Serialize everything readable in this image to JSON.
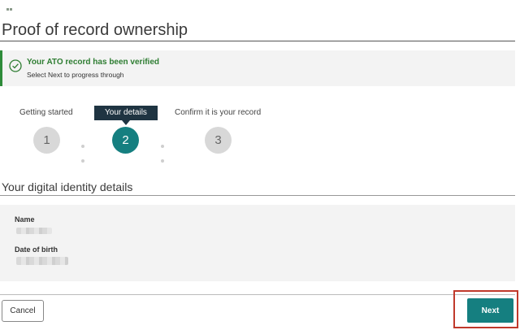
{
  "page": {
    "title": "Proof of record ownership"
  },
  "alert": {
    "title": "Your ATO record has been verified",
    "subtitle": "Select Next to progress through",
    "icon": "check-circle-icon",
    "accent_color": "#2e8b3a"
  },
  "steps": [
    {
      "label": "Getting started",
      "number": "1",
      "state": "inactive"
    },
    {
      "label": "Your details",
      "number": "2",
      "state": "active"
    },
    {
      "label": "Confirm it is your record",
      "number": "3",
      "state": "inactive"
    }
  ],
  "section": {
    "title": "Your digital identity details",
    "fields": [
      {
        "label": "Name",
        "value_redacted": true
      },
      {
        "label": "Date of birth",
        "value_redacted": true
      }
    ]
  },
  "footer": {
    "cancel_label": "Cancel",
    "next_label": "Next",
    "primary_color": "#157f80",
    "highlight_color": "#c0392b"
  }
}
